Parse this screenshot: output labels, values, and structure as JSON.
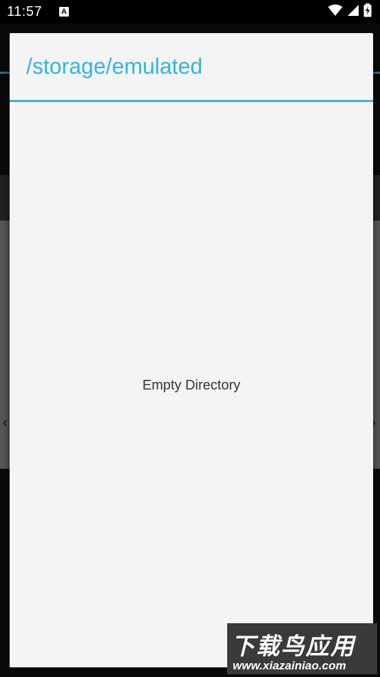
{
  "status_bar": {
    "time": "11:57",
    "notification_badge": "A",
    "icons": [
      "wifi-icon",
      "signal-icon",
      "battery-charging-icon"
    ]
  },
  "dialog": {
    "title": "/storage/emulated",
    "empty_message": "Empty Directory",
    "accent_color": "#33b5e5",
    "background_color": "#f4f4f4"
  },
  "watermark": {
    "main": "下载鸟应用",
    "url": "www.xiazainiao.com"
  }
}
